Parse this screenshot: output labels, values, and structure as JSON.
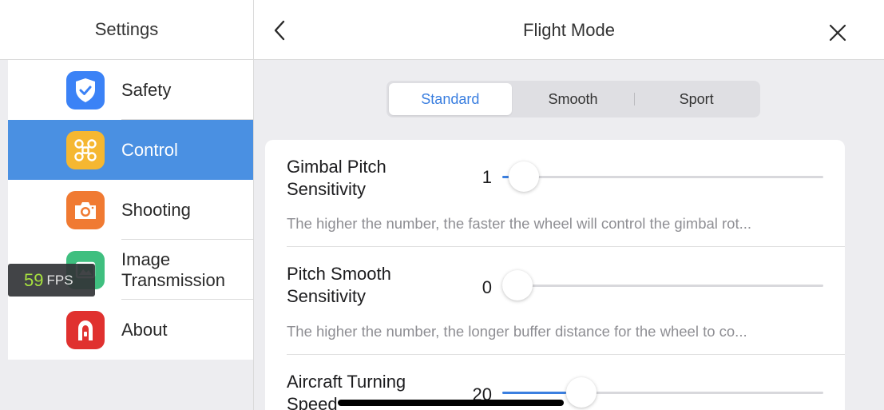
{
  "sidebar": {
    "title": "Settings",
    "items": [
      {
        "label": "Safety",
        "icon": "shield-check-icon",
        "color": "#3b82f6"
      },
      {
        "label": "Control",
        "icon": "drone-icon",
        "color": "#f5b731",
        "active": true
      },
      {
        "label": "Shooting",
        "icon": "camera-icon",
        "color": "#f07a32"
      },
      {
        "label": "Image Transmission",
        "icon": "image-transmission-icon",
        "color": "#3fbf7f"
      },
      {
        "label": "About",
        "icon": "brand-logo-icon",
        "color": "#e0312f"
      }
    ]
  },
  "fps": {
    "value": "59",
    "unit": "FPS"
  },
  "header": {
    "title": "Flight Mode"
  },
  "modes": {
    "options": [
      "Standard",
      "Smooth",
      "Sport"
    ],
    "selected": "Standard"
  },
  "settings": [
    {
      "title": "Gimbal Pitch Sensitivity",
      "value": "1",
      "fraction": 0.02,
      "description": "The higher the number, the faster the wheel will control the gimbal rot..."
    },
    {
      "title": "Pitch Smooth Sensitivity",
      "value": "0",
      "fraction": 0.0,
      "description": "The higher the number, the longer buffer distance for the wheel to co..."
    },
    {
      "title": "Aircraft Turning Speed",
      "value": "20",
      "fraction": 0.2
    }
  ],
  "colors": {
    "accent": "#3b7fe0",
    "active_row": "#4a90e2",
    "fps_number": "#a7e13f"
  }
}
